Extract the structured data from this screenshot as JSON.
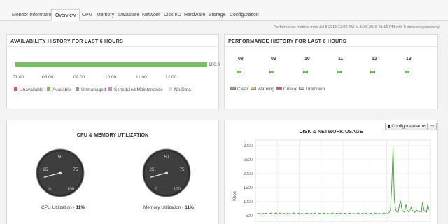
{
  "tabs": [
    {
      "label": "Monitor Information"
    },
    {
      "label": "Overview"
    },
    {
      "label": "CPU"
    },
    {
      "label": "Memory"
    },
    {
      "label": "Datastore"
    },
    {
      "label": "Network"
    },
    {
      "label": "Disk I/O"
    },
    {
      "label": "Hardware"
    },
    {
      "label": "Storage"
    },
    {
      "label": "Configuration"
    }
  ],
  "active_tab": "Overview",
  "metrics_note": "Performance metrics from Jul 8,2015 12:00 AM to Jul 8,2015 01:15 PM with 5 minutes granularity",
  "availability": {
    "title": "AVAILABILITY HISTORY FOR LAST 6 HOURS",
    "value": "100.0",
    "ticks": [
      "07:00",
      "08:00",
      "09:00",
      "10:00",
      "11:00",
      "12:00"
    ],
    "legend": [
      {
        "label": "Unavailable",
        "color": "#e0574f"
      },
      {
        "label": "Available",
        "color": "#74c061"
      },
      {
        "label": "Unmanaged",
        "color": "#9b8fd0"
      },
      {
        "label": "Scheduled Maintenance",
        "color": "#d58fd0"
      },
      {
        "label": "No Data",
        "color": "#d8d8d8"
      }
    ]
  },
  "performance": {
    "title": "PERFORMANCE HISTORY FOR LAST 6 HOURS",
    "hours": [
      "08",
      "09",
      "10",
      "11",
      "12",
      "13"
    ],
    "legend": [
      {
        "label": "Clear",
        "color": "#74c061"
      },
      {
        "label": "Warning",
        "color": "#f1cb58"
      },
      {
        "label": "Critical",
        "color": "#d9534f"
      },
      {
        "label": "Unknown",
        "color": "#cccccc"
      }
    ]
  },
  "cpu_memory": {
    "title": "CPU & MEMORY UTILIZATION",
    "gauges": [
      {
        "label": "CPU Utilization",
        "value_text": "11%",
        "value": 11,
        "ticks": [
          "0",
          "25",
          "50",
          "75",
          "100"
        ]
      },
      {
        "label": "Memory Utilization",
        "value_text": "11%",
        "value": 11,
        "ticks": [
          "0",
          "25",
          "50",
          "75",
          "100"
        ]
      }
    ]
  },
  "disk_network": {
    "title": "DISK & NETWORK USAGE",
    "configure_label": "Configure Alarms",
    "chart_data": {
      "type": "line",
      "title": "DISK & NETWORK USAGE",
      "ylabel": "Kbps",
      "yticks": [
        500,
        1000,
        1500,
        2000,
        2500,
        3000
      ],
      "ylim": [
        300,
        3200
      ],
      "color": "#3aa836",
      "values": [
        560,
        600,
        570,
        580,
        550,
        590,
        560,
        600,
        570,
        560,
        590,
        600,
        570,
        560,
        580,
        610,
        560,
        570,
        600,
        580,
        560,
        590,
        570,
        550,
        600,
        570,
        580,
        560,
        590,
        600,
        560,
        570,
        580,
        600,
        560,
        590,
        570,
        560,
        580,
        600,
        570,
        560,
        590,
        580,
        560,
        600,
        570,
        560,
        580,
        590,
        560,
        570,
        600,
        580,
        560,
        590,
        570,
        560,
        580,
        600,
        570,
        560,
        590,
        580,
        560,
        600,
        570,
        560,
        580,
        590,
        560,
        570,
        600,
        580,
        560,
        590,
        570,
        560,
        580,
        600,
        570,
        560,
        590,
        580,
        560,
        600,
        570,
        560,
        580,
        590,
        560,
        570,
        600,
        580,
        560,
        590,
        570,
        560,
        580,
        600,
        570,
        560,
        590,
        620,
        700,
        1600,
        3000,
        1100,
        700,
        640,
        620,
        900,
        1000,
        700,
        650,
        620,
        900,
        700,
        640,
        660,
        800,
        700,
        650,
        620,
        700,
        680,
        640,
        650,
        620,
        1000,
        700,
        650,
        620,
        900,
        700
      ]
    }
  }
}
